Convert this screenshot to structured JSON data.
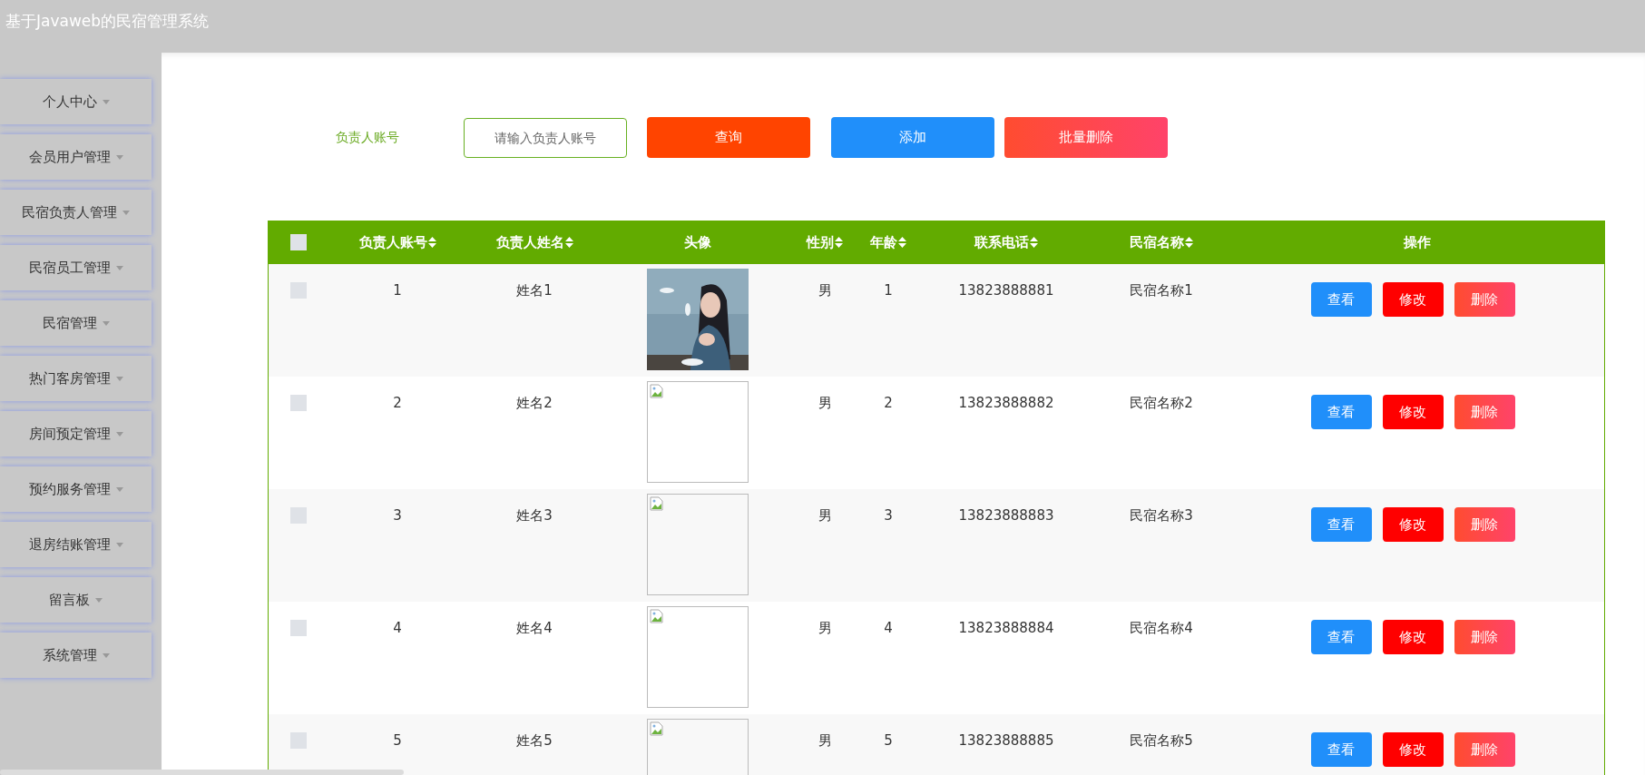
{
  "header": {
    "title": "基于Javaweb的民宿管理系统"
  },
  "sidebar": {
    "items": [
      {
        "label": "个人中心"
      },
      {
        "label": "会员用户管理"
      },
      {
        "label": "民宿负责人管理"
      },
      {
        "label": "民宿员工管理"
      },
      {
        "label": "民宿管理"
      },
      {
        "label": "热门客房管理"
      },
      {
        "label": "房间预定管理"
      },
      {
        "label": "预约服务管理"
      },
      {
        "label": "退房结账管理"
      },
      {
        "label": "留言板"
      },
      {
        "label": "系统管理"
      }
    ]
  },
  "search": {
    "label": "负责人账号",
    "placeholder": "请输入负责人账号",
    "buttons": [
      {
        "label": "查询",
        "kind": "query"
      },
      {
        "label": "添加",
        "kind": "add"
      },
      {
        "label": "批量删除",
        "kind": "bulk-delete"
      }
    ]
  },
  "table": {
    "select_all": {
      "checked": false
    },
    "columns": [
      {
        "label": "负责人账号",
        "sortable": true
      },
      {
        "label": "负责人姓名",
        "sortable": true
      },
      {
        "label": "头像",
        "sortable": false
      },
      {
        "label": "性别",
        "sortable": true
      },
      {
        "label": "年龄",
        "sortable": true
      },
      {
        "label": "联系电话",
        "sortable": true
      },
      {
        "label": "民宿名称",
        "sortable": true
      },
      {
        "label": "操作",
        "sortable": false
      }
    ],
    "rows": [
      {
        "checked": false,
        "account": "1",
        "name": "姓名1",
        "gender": "男",
        "age": "1",
        "phone": "13823888881",
        "homestay": "民宿名称1",
        "actions": [
          {
            "label": "查看",
            "kind": "view"
          },
          {
            "label": "修改",
            "kind": "edit"
          },
          {
            "label": "删除",
            "kind": "delete"
          }
        ]
      },
      {
        "checked": false,
        "account": "2",
        "name": "姓名2",
        "avatar": {
          "kind": "broken"
        },
        "gender": "男",
        "age": "2",
        "phone": "13823888882",
        "homestay": "民宿名称2",
        "actions": [
          {
            "label": "查看",
            "kind": "view"
          },
          {
            "label": "修改",
            "kind": "edit"
          },
          {
            "label": "删除",
            "kind": "delete"
          }
        ]
      },
      {
        "checked": false,
        "account": "3",
        "name": "姓名3",
        "avatar": {
          "kind": "broken"
        },
        "gender": "男",
        "age": "3",
        "phone": "13823888883",
        "homestay": "民宿名称3",
        "actions": [
          {
            "label": "查看",
            "kind": "view"
          },
          {
            "label": "修改",
            "kind": "edit"
          },
          {
            "label": "删除",
            "kind": "delete"
          }
        ]
      },
      {
        "checked": false,
        "account": "4",
        "name": "姓名4",
        "avatar": {
          "kind": "broken"
        },
        "gender": "男",
        "age": "4",
        "phone": "13823888884",
        "homestay": "民宿名称4",
        "actions": [
          {
            "label": "查看",
            "kind": "view"
          },
          {
            "label": "修改",
            "kind": "edit"
          },
          {
            "label": "删除",
            "kind": "delete"
          }
        ]
      },
      {
        "checked": false,
        "account": "5",
        "name": "姓名5",
        "avatar": {
          "kind": "broken"
        },
        "gender": "男",
        "age": "5",
        "phone": "13823888885",
        "homestay": "民宿名称5",
        "actions": [
          {
            "label": "查看",
            "kind": "view"
          },
          {
            "label": "修改",
            "kind": "edit"
          },
          {
            "label": "删除",
            "kind": "delete"
          }
        ]
      }
    ]
  }
}
